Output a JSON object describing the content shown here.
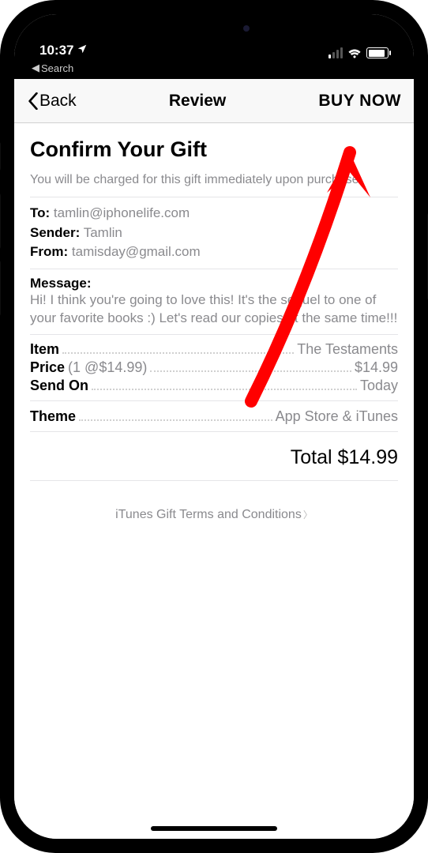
{
  "status": {
    "time": "10:37",
    "breadcrumb": "Search"
  },
  "nav": {
    "back": "Back",
    "title": "Review",
    "buy": "BUY NOW"
  },
  "page": {
    "heading": "Confirm Your Gift",
    "subtext": "You will be charged for this gift immediately upon purchase."
  },
  "recipients": {
    "to_label": "To:",
    "to_value": "tamlin@iphonelife.com",
    "sender_label": "Sender:",
    "sender_value": "Tamlin",
    "from_label": "From:",
    "from_value": "tamisday@gmail.com"
  },
  "message": {
    "label": "Message:",
    "text": "Hi! I think you're going to love this! It's the sequel to one of your favorite books :) Let's read our copies at the same time!!!"
  },
  "details": {
    "item_label": "Item",
    "item_value": "The Testaments",
    "price_label": "Price",
    "price_paren": "(1 @$14.99)",
    "price_value": "$14.99",
    "sendon_label": "Send On",
    "sendon_value": "Today",
    "theme_label": "Theme",
    "theme_value": "App Store & iTunes"
  },
  "total": {
    "label": "Total",
    "value": "$14.99"
  },
  "terms": "iTunes Gift Terms and Conditions",
  "annotation": {
    "color": "#ff0000"
  }
}
